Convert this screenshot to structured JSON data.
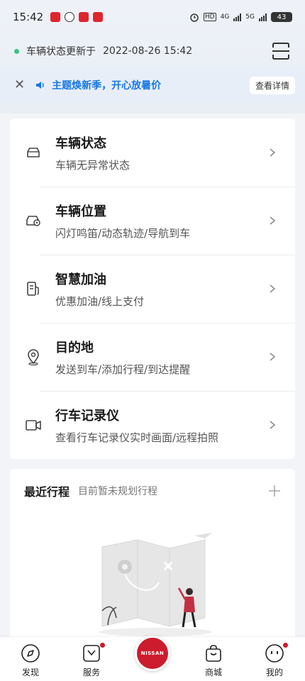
{
  "statusbar": {
    "time": "15:42",
    "battery": "43",
    "hd": "HD",
    "net1": "4G",
    "net2": "5G"
  },
  "header": {
    "status_label": "车辆状态更新于",
    "status_time": "2022-08-26 15:42"
  },
  "banner": {
    "text": "主题焕新季，开心放暑价",
    "button": "查看详情"
  },
  "menu": [
    {
      "title": "车辆状态",
      "subtitle": "车辆无异常状态"
    },
    {
      "title": "车辆位置",
      "subtitle": "闪灯鸣笛/动态轨迹/导航到车"
    },
    {
      "title": "智慧加油",
      "subtitle": "优惠加油/线上支付"
    },
    {
      "title": "目的地",
      "subtitle": "发送到车/添加行程/到达提醒"
    },
    {
      "title": "行车记录仪",
      "subtitle": "查看行车记录仪实时画面/远程拍照"
    }
  ],
  "trips": {
    "title": "最近行程",
    "subtitle": "目前暂未规划行程"
  },
  "tabbar": {
    "discover": "发现",
    "service": "服务",
    "center_logo": "NISSAN",
    "mall": "商城",
    "mine": "我的"
  },
  "colors": {
    "accent_red": "#cc1c2e",
    "banner_blue": "#1677e5",
    "status_green": "#3cc47c"
  }
}
